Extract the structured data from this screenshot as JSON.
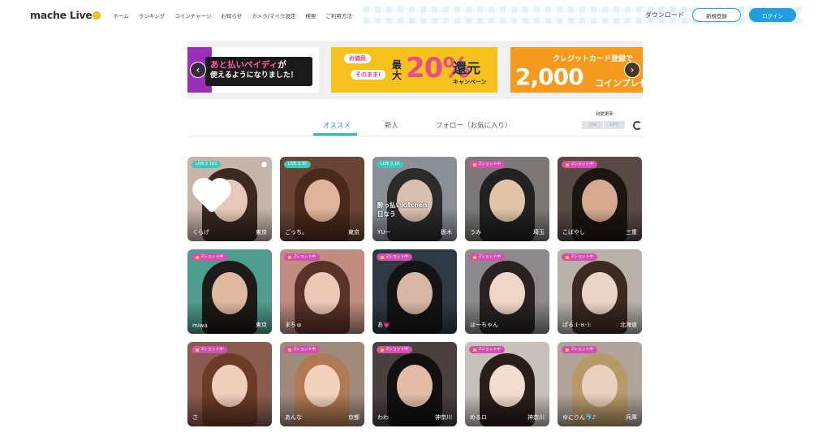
{
  "header": {
    "logo_text": "mache Live",
    "nav": [
      "ホーム",
      "ランキング",
      "コインチャージ",
      "お知らせ",
      "カメラ/マイク設定",
      "検索",
      "ご利用方法"
    ],
    "download": "ダウンロード",
    "register": "新規登録",
    "login": "ログイン"
  },
  "carousel": {
    "banner1_line1_pink": "あと払いペイディ",
    "banner1_line1_rest": "が",
    "banner1_line2": "使えるようになりました！",
    "banner2_badge1": "お値段",
    "banner2_badge2": "そのまま!",
    "banner2_max": "最大",
    "banner2_percent": "20%",
    "banner2_kangen": "還元",
    "banner2_campaign": "キャンペーン",
    "banner3_line1": "クレジットカード登録で",
    "banner3_amount": "2,000",
    "banner3_coin": "コインプレゼ",
    "prev_icon": "chevron-left-icon",
    "next_icon": "chevron-right-icon"
  },
  "tabs": {
    "items": [
      "オススメ",
      "新人",
      "フォロー（お気に入り）"
    ],
    "active": "オススメ",
    "auto_refresh_label": "自動更新",
    "on": "ON",
    "off": "OFF"
  },
  "cards": [
    {
      "badge": "LIVE  ♀ 163",
      "type": "live",
      "name": "くらげ",
      "location": "東京",
      "bg": "#c9b4a9",
      "face": "#e8c8b8",
      "hair": "#3a2a22"
    },
    {
      "badge": "LIVE  ♀ 35",
      "type": "live",
      "name": "ごっち。",
      "location": "東京",
      "bg": "#6a4434",
      "face": "#e0b49a",
      "hair": "#4a2a1c"
    },
    {
      "badge": "LIVE  ♀ 18",
      "type": "live",
      "name": "YU一",
      "location": "栃木",
      "bg": "#8a8f98",
      "face": "#d9c0b0",
      "hair": "#2b2b2b",
      "overlay": "酔っ払いkitchen\n日なう"
    },
    {
      "badge": "2ショット中",
      "type": "shot",
      "name": "うみ",
      "location": "埼玉",
      "bg": "#7d7775",
      "face": "#e2c4a8",
      "hair": "#222222"
    },
    {
      "badge": "2ショット中",
      "type": "shot",
      "name": "こばやし",
      "location": "三重",
      "bg": "#5a4a44",
      "face": "#d7a98e",
      "hair": "#1c1612"
    },
    {
      "badge": "2ショット中",
      "type": "shot",
      "name": "miwa",
      "location": "東京",
      "bg": "#4f9d8f",
      "face": "#dfb8a0",
      "hair": "#1e1a18"
    },
    {
      "badge": "2ショット中",
      "type": "shot",
      "name": "まちゅ",
      "location": "",
      "bg": "#c08d80",
      "face": "#ecc8b6",
      "hair": "#5a3328"
    },
    {
      "badge": "2ショット中",
      "type": "shot",
      "name": "あ💗",
      "location": "",
      "bg": "#2e3a44",
      "face": "#d8b6a6",
      "hair": "#141414"
    },
    {
      "badge": "2ショット中",
      "type": "shot",
      "name": "は一ちゃん",
      "location": "",
      "bg": "#8c8a8c",
      "face": "#f0d6c8",
      "hair": "#2a2222"
    },
    {
      "badge": "2ショット中",
      "type": "shot",
      "name": "ぱる:(-ㅂ-):",
      "location": "北海道",
      "bg": "#b8b2aa",
      "face": "#ead6c8",
      "hair": "#3c2a20"
    },
    {
      "badge": "2ショット中",
      "type": "shot",
      "name": "さ",
      "location": "",
      "bg": "#8a5c50",
      "face": "#f0cfbc",
      "hair": "#6b3b28"
    },
    {
      "badge": "2ショット中",
      "type": "shot",
      "name": "あんな",
      "location": "京都",
      "bg": "#a08a7c",
      "face": "#f2d2bc",
      "hair": "#b07a54"
    },
    {
      "badge": "2ショット中",
      "type": "shot",
      "name": "わわ",
      "location": "神奈川",
      "bg": "#4a4040",
      "face": "#e2bca6",
      "hair": "#121010"
    },
    {
      "badge": "2ショット中",
      "type": "shot",
      "name": "めるロ",
      "location": "神奈川",
      "bg": "#c8c0bc",
      "face": "#f2dccf",
      "hair": "#2a1e1a"
    },
    {
      "badge": "2ショット中",
      "type": "shot",
      "name": "ゆにりん🐬♪",
      "location": "兵庫",
      "bg": "#b0a49a",
      "face": "#ead0be",
      "hair": "#b89a6a"
    }
  ]
}
